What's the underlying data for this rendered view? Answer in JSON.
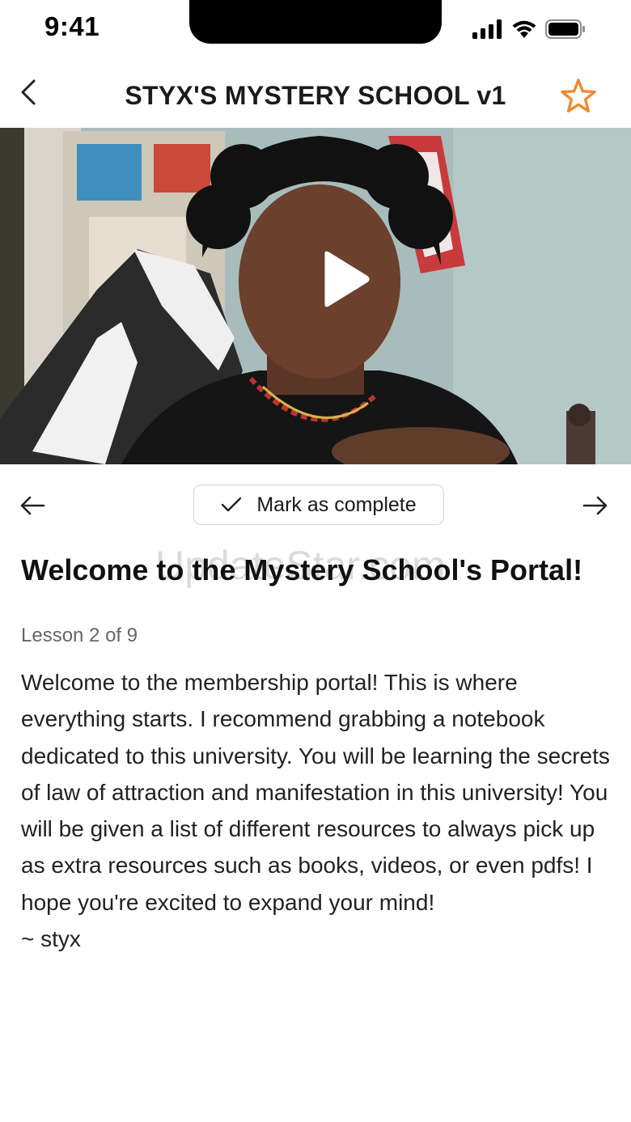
{
  "status_bar": {
    "time": "9:41",
    "icons": [
      "signal-icon",
      "wifi-icon",
      "battery-icon"
    ]
  },
  "header": {
    "back_icon": "chevron-left-icon",
    "title": "STYX'S MYSTERY SCHOOL v1",
    "favorite_icon": "star-icon",
    "accent_color": "#F0892E"
  },
  "video": {
    "play_icon": "play-icon"
  },
  "lesson_nav": {
    "prev_icon": "arrow-left-icon",
    "mark_complete_label": "Mark as complete",
    "check_icon": "checkmark-icon",
    "next_icon": "arrow-right-icon"
  },
  "lesson": {
    "title": "Welcome to the Mystery School's Portal!",
    "watermark": "UpdateStar.com",
    "progress": "Lesson 2 of 9",
    "body": "Welcome to the membership portal! This is where everything starts. I recommend grabbing a notebook dedicated to this university. You will be learning the secrets of law of attraction and manifestation in this university! You will be given a list of different resources to always pick up as extra resources such as books, videos, or even pdfs! I hope you're excited to expand your mind!",
    "signature": "~ styx"
  }
}
